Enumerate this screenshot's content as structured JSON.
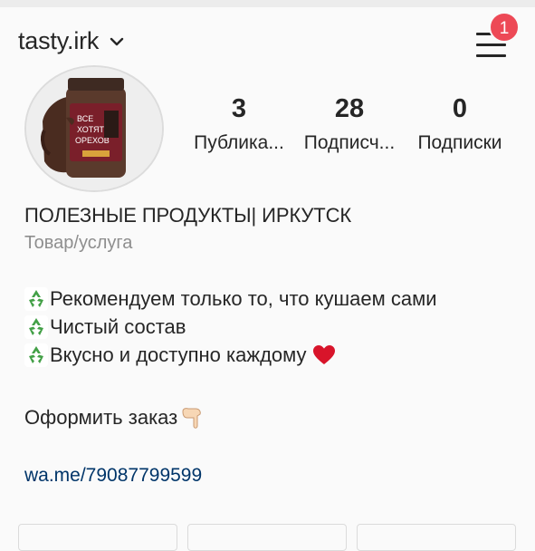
{
  "header": {
    "username": "tasty.irk",
    "notification_count": "1"
  },
  "stats": [
    {
      "value": "3",
      "label": "Публика..."
    },
    {
      "value": "28",
      "label": "Подписч..."
    },
    {
      "value": "0",
      "label": "Подписки"
    }
  ],
  "avatar": {
    "jar_label_line1": "ВСЕ",
    "jar_label_line2": "ХОТЯТ",
    "jar_label_line3": "ОРЕХОВ"
  },
  "profile": {
    "business_name": "ПОЛЕЗНЫЕ ПРОДУКТЫ| ИРКУТСК",
    "category": "Товар/услуга"
  },
  "bio": {
    "line1": "Рекомендуем только то, что кушаем сами",
    "line2": "Чистый состав",
    "line3": "Вкусно и доступно каждому",
    "order": "Оформить заказ",
    "link": "wa.me/79087799599"
  },
  "colors": {
    "badge": "#ed4956",
    "link": "#003569",
    "secondary_text": "#8e8e8e",
    "recycle_green": "#43a047",
    "heart_red": "#d8142a"
  },
  "icons": {
    "menu": "hamburger-icon",
    "dropdown": "chevron-down-icon",
    "bio_bullet": "recycle-icon",
    "heart": "heart-icon",
    "pointer": "backhand-index-pointing-down-icon"
  }
}
